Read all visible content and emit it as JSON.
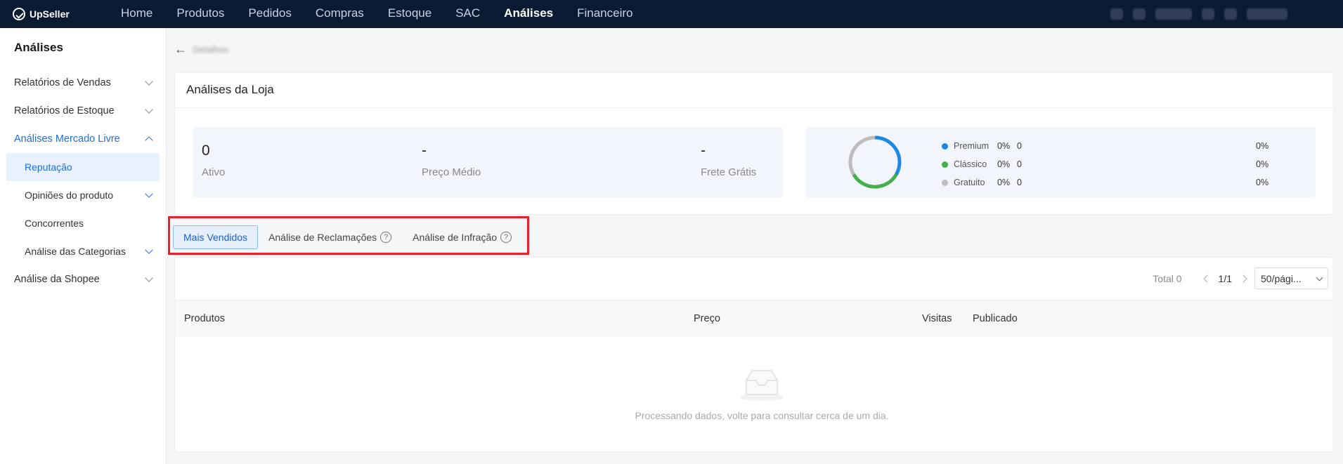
{
  "app": {
    "name": "UpSeller"
  },
  "nav": [
    {
      "label": "Home"
    },
    {
      "label": "Produtos"
    },
    {
      "label": "Pedidos"
    },
    {
      "label": "Compras"
    },
    {
      "label": "Estoque"
    },
    {
      "label": "SAC"
    },
    {
      "label": "Análises"
    },
    {
      "label": "Financeiro"
    }
  ],
  "sidebar": {
    "title": "Análises",
    "items": [
      {
        "label": "Relatórios de Vendas"
      },
      {
        "label": "Relatórios de Estoque"
      },
      {
        "label": "Análises Mercado Livre"
      },
      {
        "label": "Reputação"
      },
      {
        "label": "Opiniões do produto"
      },
      {
        "label": "Concorrentes"
      },
      {
        "label": "Análise das Categorias"
      },
      {
        "label": "Análise da Shopee"
      }
    ]
  },
  "breadcrumb": {
    "text": "Detalhes"
  },
  "store_card": {
    "title": "Análises da Loja",
    "stats": [
      {
        "value": "0",
        "label": "Ativo"
      },
      {
        "value": "-",
        "label": "Preço Médio"
      },
      {
        "value": "-",
        "label": "Frete Grátis"
      }
    ],
    "legend": [
      {
        "name": "Premium",
        "pct": "0%",
        "count": "0",
        "pct2": "0%",
        "color": "#1e88e5"
      },
      {
        "name": "Clássico",
        "pct": "0%",
        "count": "0",
        "pct2": "0%",
        "color": "#43b049"
      },
      {
        "name": "Gratuito",
        "pct": "0%",
        "count": "0",
        "pct2": "0%",
        "color": "#bdbdbd"
      }
    ]
  },
  "tabs": [
    {
      "label": "Mais Vendidos"
    },
    {
      "label": "Análise de Reclamações"
    },
    {
      "label": "Análise de Infração"
    }
  ],
  "pager": {
    "total": "Total 0",
    "page": "1/1",
    "page_size": "50/pági..."
  },
  "table": {
    "columns": [
      "Produtos",
      "Preço",
      "Visitas",
      "Publicado"
    ],
    "empty_text": "Processando dados, volte para consultar cerca de um dia."
  },
  "colors": {
    "nav_bg": "#0b1a33",
    "accent": "#1f6fe0",
    "highlight": "#e8222b"
  }
}
